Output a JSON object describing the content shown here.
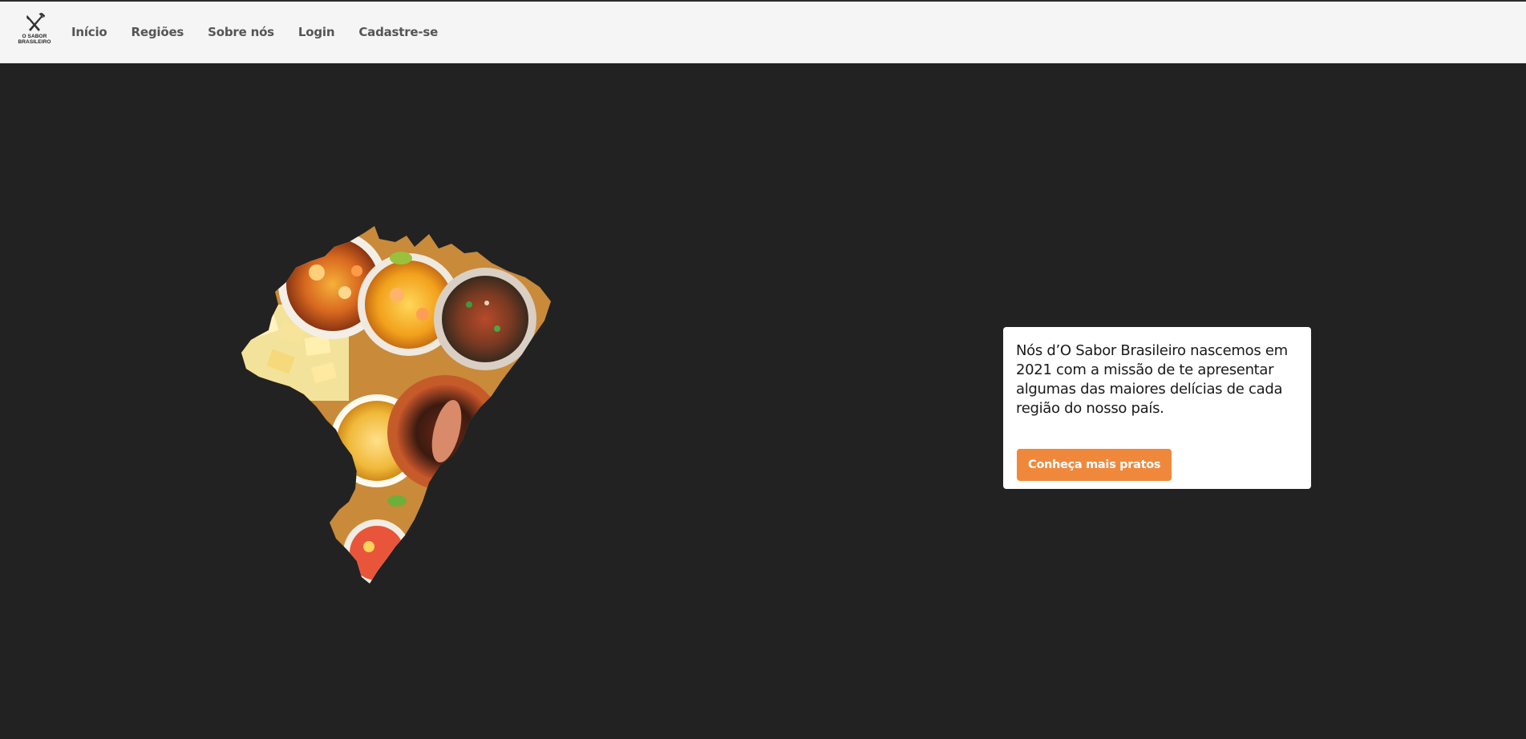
{
  "app": {
    "logo_text": "O SABOR\nBRASILEIRO"
  },
  "nav": {
    "items": [
      {
        "label": "Início"
      },
      {
        "label": "Regiões"
      },
      {
        "label": "Sobre nós"
      },
      {
        "label": "Login"
      },
      {
        "label": "Cadastre-se"
      }
    ]
  },
  "hero": {
    "image_icon": "brazil-food-map-image",
    "card_text": "Nós d’O Sabor Brasileiro nascemos em 2021 com a missão de te apresentar algumas das maiores delícias de cada região do nosso país.",
    "button_label": "Conheça mais pratos"
  },
  "colors": {
    "background": "#222222",
    "navbar": "#f5f5f5",
    "accent": "#f0883c",
    "nav_text": "#555555"
  }
}
